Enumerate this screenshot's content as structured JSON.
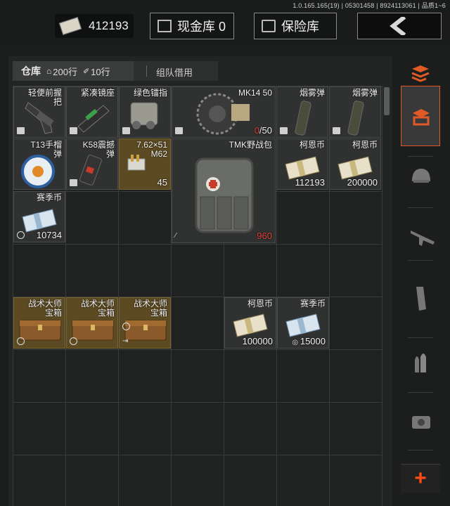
{
  "version_text": "1.0.165.165(19) | 05301458 | 8924113061 | 品质1~6",
  "header": {
    "currency_value": "412193",
    "cash_vault_label": "现金库 0",
    "safe_label": "保险库"
  },
  "tabs": {
    "warehouse_label": "仓库",
    "rows_count": "200行",
    "pinned_rows": "10行",
    "team_borrow_label": "组队借用"
  },
  "items": {
    "grip": {
      "name": "轻便前握\n把"
    },
    "scope_mount": {
      "name": "紧凑镜座"
    },
    "green_laser": {
      "name": "绿色镭指"
    },
    "mk14_mag": {
      "name": "MK14 50",
      "qty_current": "0",
      "qty_total": "/50"
    },
    "smoke1": {
      "name": "烟雾弹"
    },
    "smoke2": {
      "name": "烟雾弹"
    },
    "t13_grenade": {
      "name": "T13手榴\n弹"
    },
    "k58_grenade": {
      "name": "K58震撼\n弹"
    },
    "ammo_762": {
      "name": "7.62×51\nM62",
      "qty": "45"
    },
    "tmk_backpack": {
      "name": "TMK野战包",
      "qty": "960"
    },
    "koen1": {
      "name": "柯恩币",
      "qty": "112193"
    },
    "koen2": {
      "name": "柯恩币",
      "qty": "200000"
    },
    "season1": {
      "name": "赛季币",
      "qty": "10734"
    },
    "chest1": {
      "name": "战术大师\n宝箱"
    },
    "chest2": {
      "name": "战术大师\n宝箱"
    },
    "chest3": {
      "name": "战术大师\n宝箱"
    },
    "koen3": {
      "name": "柯恩币",
      "qty": "100000"
    },
    "season2": {
      "name": "赛季币",
      "qty": "15000"
    }
  },
  "colors": {
    "accent": "#e05a28",
    "gold_cell": "#5c4a22",
    "red_qty": "#e0403a"
  },
  "sidebar_icons": [
    "layers-icon",
    "warehouse-icon",
    "helmet-icon",
    "rifle-icon",
    "magazine-icon",
    "ammo-icon",
    "sight-icon",
    "plus-icon"
  ]
}
